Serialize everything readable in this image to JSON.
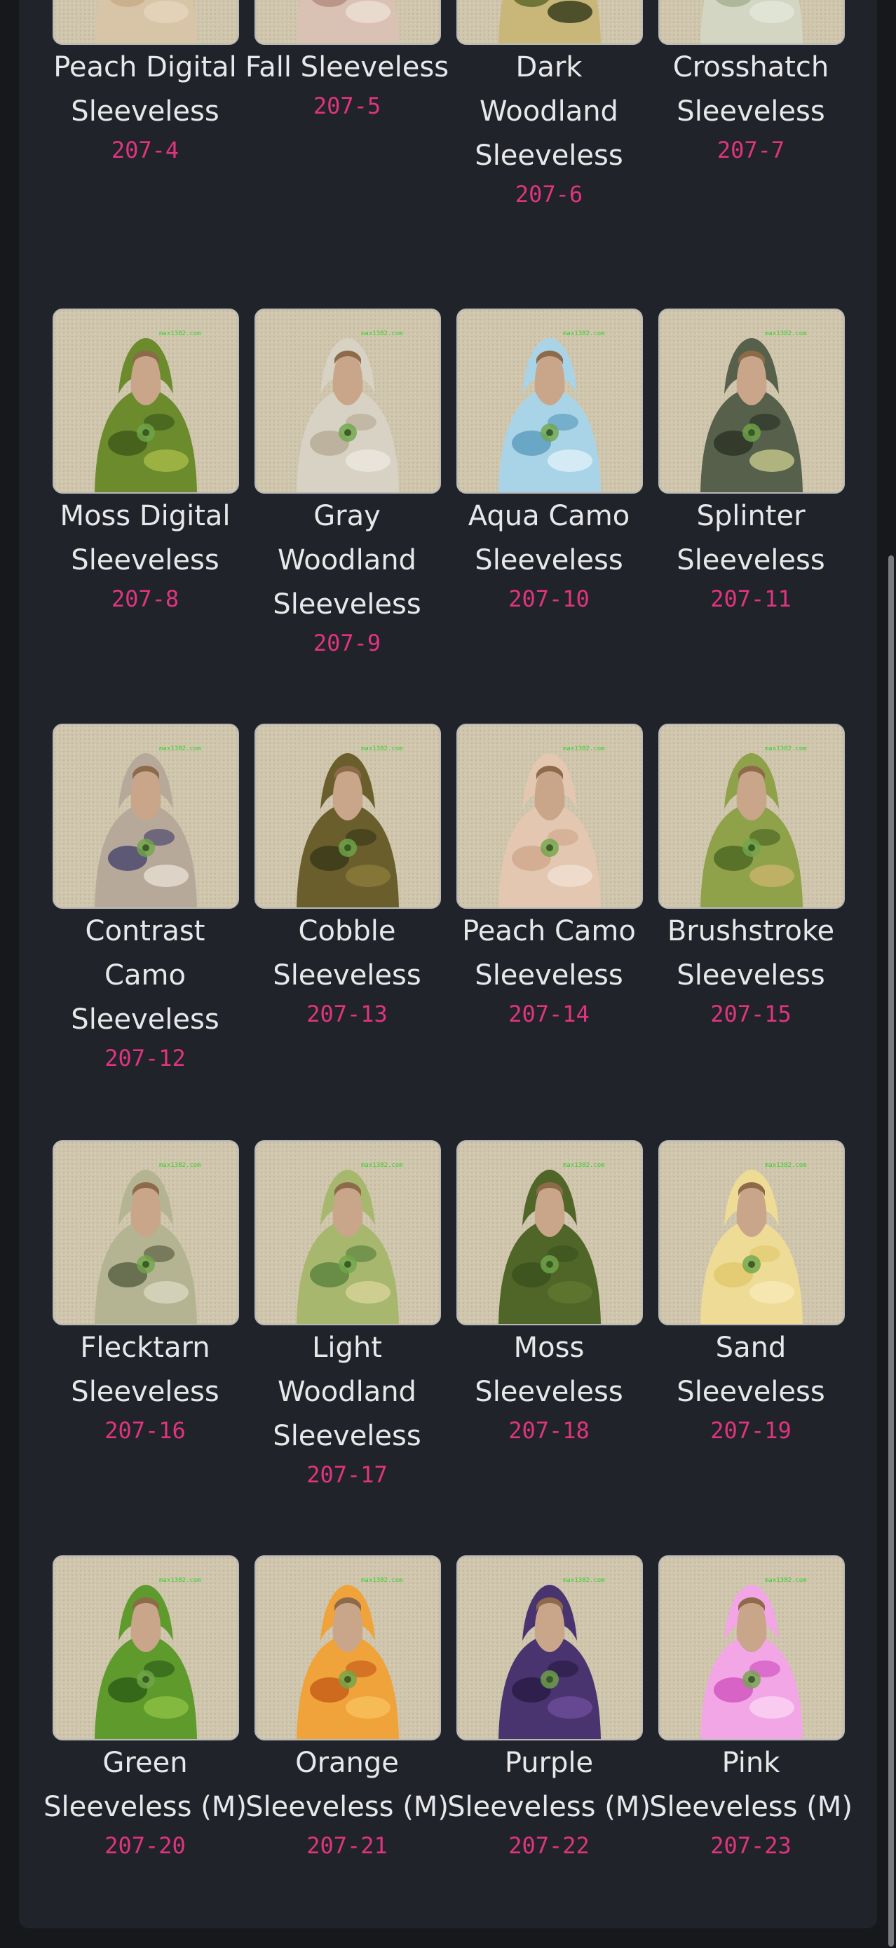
{
  "rows": [
    {
      "items": [
        {
          "name": "Peach Digital Sleeveless",
          "code": "207-4",
          "top": "#d8c4a6",
          "mid": "#c9ad8a",
          "acc": "#e6d6bd"
        },
        {
          "name": "Fall Sleeveless",
          "code": "207-5",
          "top": "#d9c2b4",
          "mid": "#b48e80",
          "acc": "#ece0d6"
        },
        {
          "name": "Dark Woodland Sleeveless",
          "code": "207-6",
          "top": "#c9b77a",
          "mid": "#5f6a2c",
          "acc": "#2f3418"
        },
        {
          "name": "Crosshatch Sleeveless",
          "code": "207-7",
          "top": "#d2d6c2",
          "mid": "#a9b293",
          "acc": "#e4e7d8"
        }
      ]
    },
    {
      "items": [
        {
          "name": "Moss Digital Sleeveless",
          "code": "207-8",
          "top": "#6c8b2c",
          "mid": "#3f5b1b",
          "acc": "#a7bb4a"
        },
        {
          "name": "Gray Woodland Sleeveless",
          "code": "207-9",
          "top": "#d8d2c4",
          "mid": "#b9ad98",
          "acc": "#ece8df"
        },
        {
          "name": "Aqua Camo Sleeveless",
          "code": "207-10",
          "top": "#a9d4e8",
          "mid": "#5f9fbf",
          "acc": "#dff0f7"
        },
        {
          "name": "Splinter Sleeveless",
          "code": "207-11",
          "top": "#56604a",
          "mid": "#2e3528",
          "acc": "#c6c98c"
        }
      ]
    },
    {
      "items": [
        {
          "name": "Contrast Camo Sleeveless",
          "code": "207-12",
          "top": "#b7a99a",
          "mid": "#4e4a6e",
          "acc": "#e6ded2"
        },
        {
          "name": "Cobble Sleeveless",
          "code": "207-13",
          "top": "#6a5f2c",
          "mid": "#3b3a1a",
          "acc": "#8c7c3b"
        },
        {
          "name": "Peach Camo Sleeveless",
          "code": "207-14",
          "top": "#e3c7b0",
          "mid": "#d0a98e",
          "acc": "#f1e0d2"
        },
        {
          "name": "Brushstroke Sleeveless",
          "code": "207-15",
          "top": "#8fa24a",
          "mid": "#4f6a24",
          "acc": "#c9b46c"
        }
      ]
    },
    {
      "items": [
        {
          "name": "Flecktarn Sleeveless",
          "code": "207-16",
          "top": "#b4b493",
          "mid": "#5c6345",
          "acc": "#d9d7bf"
        },
        {
          "name": "Light Woodland Sleeveless",
          "code": "207-17",
          "top": "#a7b86e",
          "mid": "#5e8440",
          "acc": "#d8d39a"
        },
        {
          "name": "Moss Sleeveless",
          "code": "207-18",
          "top": "#4f6628",
          "mid": "#3c521e",
          "acc": "#60782f"
        },
        {
          "name": "Sand Sleeveless",
          "code": "207-19",
          "top": "#eedc96",
          "mid": "#e2c96e",
          "acc": "#f7eab8"
        }
      ]
    },
    {
      "items": [
        {
          "name": "Green Sleeveless (M)",
          "code": "207-20",
          "top": "#5f9a2c",
          "mid": "#2f5f18",
          "acc": "#8cc044"
        },
        {
          "name": "Orange Sleeveless (M)",
          "code": "207-21",
          "top": "#f0a23b",
          "mid": "#c8601a",
          "acc": "#f7c25c"
        },
        {
          "name": "Purple Sleeveless (M)",
          "code": "207-22",
          "top": "#4a3470",
          "mid": "#2a1c46",
          "acc": "#6b4d9a"
        },
        {
          "name": "Pink Sleeveless (M)",
          "code": "207-23",
          "top": "#f2a6e6",
          "mid": "#d257c0",
          "acc": "#fbd4f3"
        }
      ]
    }
  ],
  "colors": {
    "page": "#17181c",
    "panel": "#202329",
    "name": "#e8e8ea",
    "code": "#e0347f"
  }
}
